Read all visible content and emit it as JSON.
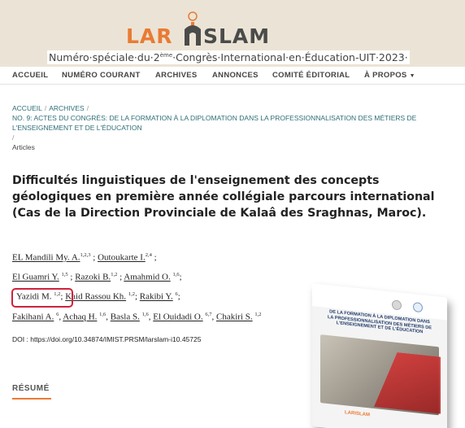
{
  "header": {
    "logo_left": "LAR",
    "logo_right": "SLAM",
    "subtitle_pre": "Numéro·spéciale·du·2",
    "subtitle_sup": "ème",
    "subtitle_post": "·Congrès·International·en·Éducation-UIT·2023·",
    "colors": {
      "band": "#ebe4d6",
      "accent": "#e97b34",
      "dark": "#4b4b4b"
    }
  },
  "nav": {
    "items": [
      "ACCUEIL",
      "NUMÉRO COURANT",
      "ARCHIVES",
      "ANNONCES",
      "COMITÉ ÉDITORIAL",
      "À PROPOS"
    ],
    "caret_icon": "caret-down-icon"
  },
  "breadcrumb": {
    "home": "ACCUEIL",
    "archives": "ARCHIVES",
    "issue": "NO. 9: ACTES DU CONGRÈS: DE LA FORMATION À LA DIPLOMATION DANS LA PROFESSIONNALISATION DES MÉTIERS DE L'ENSEIGNEMENT ET DE L'ÉDUCATION",
    "current": "Articles",
    "sep": "/"
  },
  "article": {
    "title": "Difficultés linguistiques de l'enseignement des concepts géologiques en première année collégiale parcours international (Cas de la Direction Provinciale de Kalaâ des Sraghnas, Maroc).",
    "authors": {
      "a1": "EL Mandili My. A.",
      "a1_sup": "1,2,3",
      "a2": "Outoukarte I.",
      "a2_sup": "2,4",
      "a3": "El Guamri Y.",
      "a3_sup": "1,5",
      "a4": "Razoki B.",
      "a4_sup": "1,2",
      "a5": "Amahmid O.",
      "a5_sup": "1,6",
      "a6": "Yazidi M.",
      "a6_sup": "1,2",
      "a7": "Kaid Rassou Kh.",
      "a7_sup": "1,2",
      "a8": "Rakibi Y.",
      "a8_sup": "6",
      "a9": "Fakihani A.",
      "a9_sup": "6",
      "a10": "Achaq H.",
      "a10_sup": "1,6",
      "a11": "Basla S.",
      "a11_sup": "1,6",
      "a12": "El Ouidadi O.",
      "a12_sup": "6,7",
      "a13": "Chakiri S.",
      "a13_sup": "1,2"
    },
    "doi_label": "DOI :",
    "doi_url": "https://doi.org/10.34874/IMIST.PRSM/larslam-i10.45725",
    "resume_label": "RÉSUMÉ"
  },
  "cover": {
    "title": "DE LA FORMATION À LA DIPLOMATION DANS LA PROFESSIONNALISATION DES MÉTIERS DE L'ENSEIGNEMENT ET DE L'ÉDUCATION",
    "logo": "LARISLAM",
    "colors": {
      "title": "#1f3a6a",
      "red": "#c12424"
    }
  },
  "highlight_color": "#d0213a"
}
